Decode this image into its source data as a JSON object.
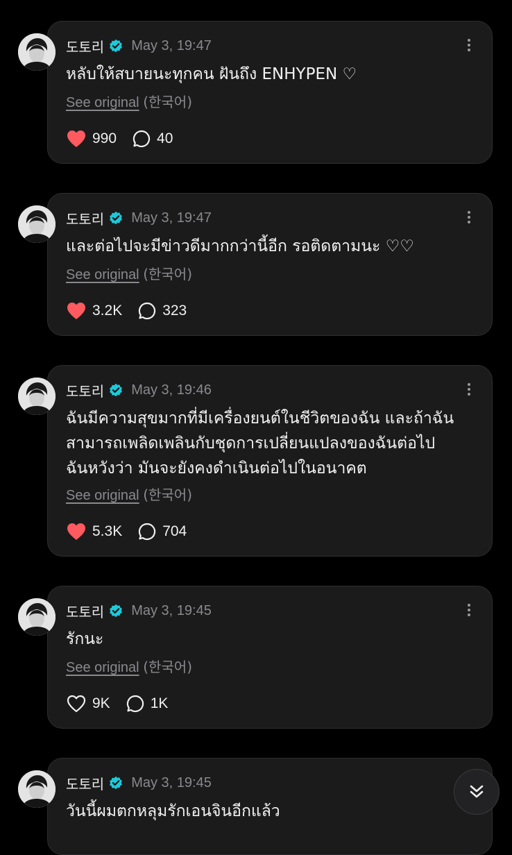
{
  "posts": [
    {
      "author": "도토리",
      "time": "May 3, 19:47",
      "text": "หลับให้สบายนะทุกคน ฝันถึง ENHYPEN ♡",
      "see_original": "See original",
      "lang": "(한국어)",
      "likes": "990",
      "comments": "40",
      "liked": true
    },
    {
      "author": "도토리",
      "time": "May 3, 19:47",
      "text": "และต่อไปจะมีข่าวดีมากกว่านี้อีก รอติดตามนะ ♡♡",
      "see_original": "See original",
      "lang": "(한국어)",
      "likes": "3.2K",
      "comments": "323",
      "liked": true
    },
    {
      "author": "도토리",
      "time": "May 3, 19:46",
      "text": "ฉันมีความสุขมากที่มีเครื่องยนต์ในชีวิตของฉัน และถ้าฉัน\nสามารถเพลิดเพลินกับชุดการเปลี่ยนแปลงของฉันต่อไป\nฉันหวังว่า มันจะยังคงดำเนินต่อไปในอนาคต",
      "see_original": "See original",
      "lang": "(한국어)",
      "likes": "5.3K",
      "comments": "704",
      "liked": true
    },
    {
      "author": "도토리",
      "time": "May 3, 19:45",
      "text": "รักนะ",
      "see_original": "See original",
      "lang": "(한국어)",
      "likes": "9K",
      "comments": "1K",
      "liked": false
    },
    {
      "author": "도토리",
      "time": "May 3, 19:45",
      "text": "วันนี้ผมตกหลุมรักเอนจินอีกแล้ว"
    }
  ],
  "colors": {
    "background": "#000000",
    "bubble": "#1b1b1c",
    "liked_heart": "#ff5a5f",
    "verified_badge": "#1ec8d8",
    "muted_text": "#8a8a8e"
  },
  "icons": {
    "like": "heart-icon",
    "comment": "speech-bubble-icon",
    "verified": "verified-badge-icon",
    "more": "more-vertical-icon",
    "scroll": "double-chevron-down-icon"
  }
}
